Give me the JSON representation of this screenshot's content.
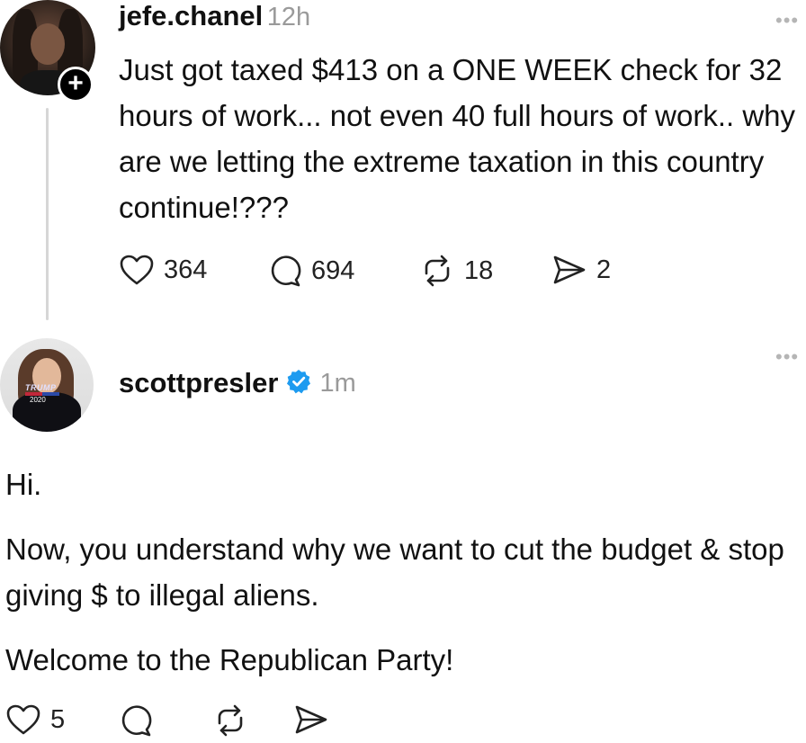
{
  "posts": [
    {
      "username": "jefe.chanel",
      "time": "12h",
      "more_label": "•••",
      "follow_symbol": "+",
      "body": "Just got taxed $413 on a ONE WEEK check for 32 hours of work... not even 40 full hours of work.. why are we letting the extreme taxation in this country continue!???",
      "likes": "364",
      "replies": "694",
      "reposts": "18",
      "shares": "2"
    },
    {
      "username": "scottpresler",
      "verified": true,
      "time": "1m",
      "more_label": "•••",
      "paragraphs": [
        "Hi.",
        "Now, you understand why we want to cut the budget & stop giving $ to illegal aliens.",
        "Welcome to the Republican Party!"
      ],
      "likes": "5",
      "avatar_shirt_text": [
        "TRUMP",
        "2020"
      ]
    }
  ],
  "icons": {
    "like": "heart-icon",
    "reply": "speech-bubble-icon",
    "repost": "repost-arrows-icon",
    "share": "paper-plane-icon",
    "verified": "verified-badge-icon",
    "verified_color": "#1d9bf0"
  }
}
